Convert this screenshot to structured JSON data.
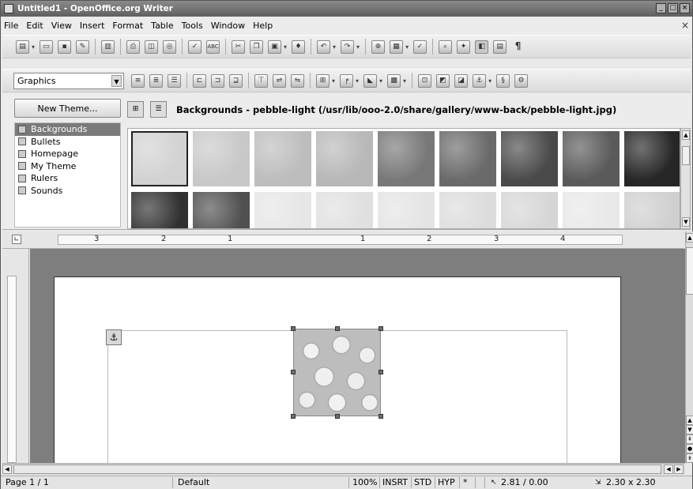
{
  "window": {
    "title": "Untitled1 - OpenOffice.org Writer",
    "controls": [
      "_",
      "□",
      "×"
    ]
  },
  "menu": {
    "items": [
      "File",
      "Edit",
      "View",
      "Insert",
      "Format",
      "Table",
      "Tools",
      "Window",
      "Help"
    ],
    "close": "×"
  },
  "toolbar": {
    "style_value": "Graphics",
    "abc_label": "ABC",
    "pilcrow": "¶"
  },
  "gallery": {
    "new_theme_label": "New Theme...",
    "path_label": "Backgrounds - pebble-light (/usr/lib/ooo-2.0/share/gallery/www-back/pebble-light.jpg)",
    "themes": [
      {
        "label": "Backgrounds",
        "selected": true
      },
      {
        "label": "Bullets",
        "selected": false
      },
      {
        "label": "Homepage",
        "selected": false
      },
      {
        "label": "My Theme",
        "selected": false
      },
      {
        "label": "Rulers",
        "selected": false
      },
      {
        "label": "Sounds",
        "selected": false
      }
    ],
    "row1_colors": [
      "#d2d2d2",
      "#c8c8c8",
      "#bdbdbd",
      "#b8b8b8",
      "#787878",
      "#6a6a6a",
      "#4a4a4a",
      "#5a5a5a",
      "#262626"
    ],
    "row2_colors": [
      "#303030",
      "#505050",
      "#e6e6e6",
      "#e0e0e0",
      "#e4e4e4",
      "#dcdcdc",
      "#d6d6d6",
      "#e8e8e8",
      "#cfcfcf"
    ]
  },
  "ruler": {
    "labels": [
      "3",
      "2",
      "1",
      "1",
      "2",
      "3",
      "4"
    ]
  },
  "status": {
    "page": "Page 1 / 1",
    "style": "Default",
    "zoom": "100%",
    "insert_mode": "INSRT",
    "selection_mode": "STD",
    "hyperlink_mode": "HYP",
    "modified": "*",
    "position": "2.81 / 0.00",
    "size": "2.30 x 2.30"
  },
  "colors": {
    "title_bar": "#6a6a6a",
    "doc_background": "#7e7e7e",
    "selected_theme": "#7a7a7a"
  }
}
